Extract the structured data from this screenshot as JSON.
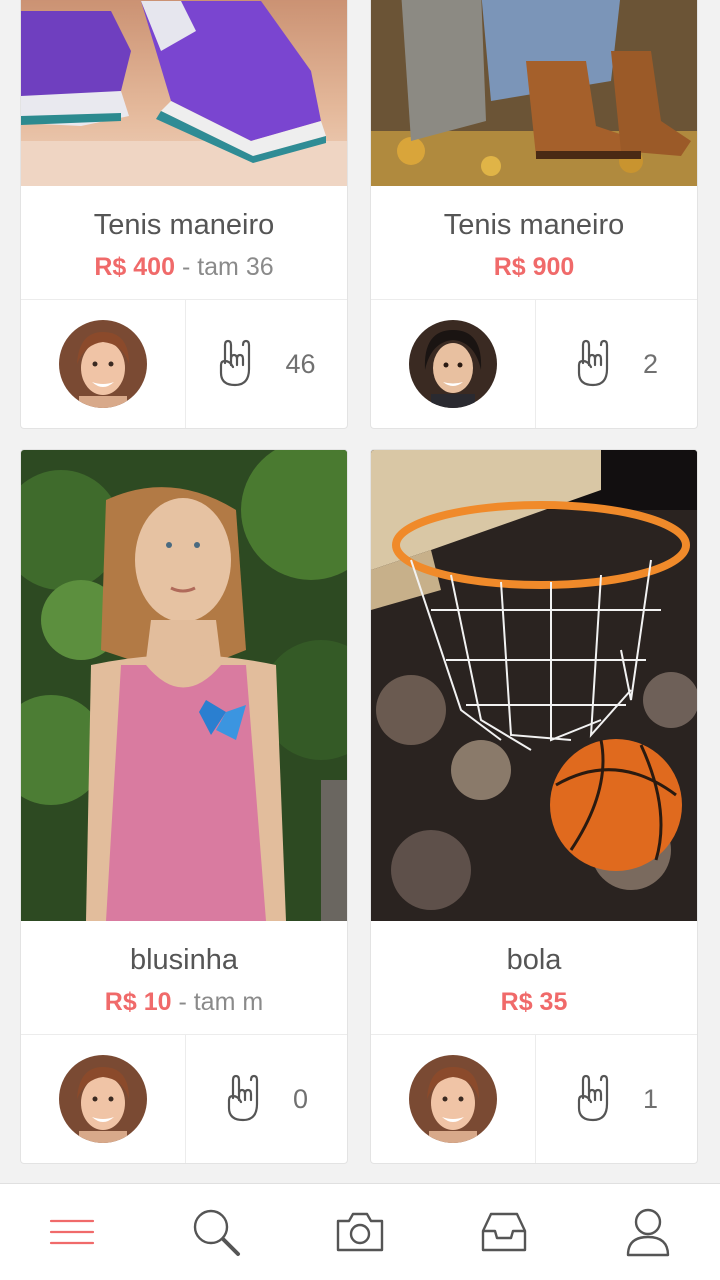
{
  "products": [
    {
      "title": "Tenis maneiro",
      "price": "R$ 400",
      "size": "- tam 36",
      "likes": "46",
      "photo": "purple-sneakers-photo",
      "seller_avatar": "woman-red-hair-avatar"
    },
    {
      "title": "Tenis maneiro",
      "price": "R$ 900",
      "size": "",
      "likes": "2",
      "photo": "brown-boots-photo",
      "seller_avatar": "woman-dark-hair-avatar"
    },
    {
      "title": "blusinha",
      "price": "R$ 10",
      "size": "- tam m",
      "likes": "0",
      "photo": "woman-pink-top-photo",
      "seller_avatar": "woman-red-hair-avatar"
    },
    {
      "title": "bola",
      "price": "R$ 35",
      "size": "",
      "likes": "1",
      "photo": "basketball-hoop-photo",
      "seller_avatar": "woman-red-hair-avatar"
    }
  ],
  "nav": [
    {
      "icon": "menu-icon",
      "active": true
    },
    {
      "icon": "search-icon",
      "active": false
    },
    {
      "icon": "camera-icon",
      "active": false
    },
    {
      "icon": "inbox-icon",
      "active": false
    },
    {
      "icon": "profile-icon",
      "active": false
    }
  ],
  "colors": {
    "price": "#f06a6a",
    "active_nav": "#f06a6a",
    "icon": "#555555"
  }
}
